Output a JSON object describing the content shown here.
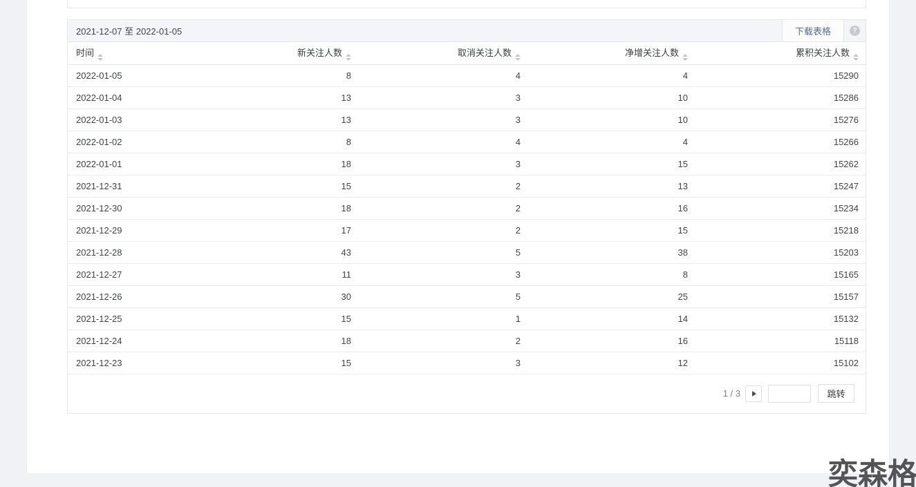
{
  "page": {
    "watermark": "奕森格"
  },
  "card": {
    "date_range": "2021-12-07 至 2022-01-05",
    "download_label": "下载表格",
    "help_icon_glyph": "?",
    "columns": [
      {
        "label": "时间",
        "align": "left"
      },
      {
        "label": "新关注人数",
        "align": "right"
      },
      {
        "label": "取消关注人数",
        "align": "right"
      },
      {
        "label": "净增关注人数",
        "align": "right"
      },
      {
        "label": "累积关注人数",
        "align": "right"
      }
    ],
    "rows": [
      [
        "2022-01-05",
        "8",
        "4",
        "4",
        "15290"
      ],
      [
        "2022-01-04",
        "13",
        "3",
        "10",
        "15286"
      ],
      [
        "2022-01-03",
        "13",
        "3",
        "10",
        "15276"
      ],
      [
        "2022-01-02",
        "8",
        "4",
        "4",
        "15266"
      ],
      [
        "2022-01-01",
        "18",
        "3",
        "15",
        "15262"
      ],
      [
        "2021-12-31",
        "15",
        "2",
        "13",
        "15247"
      ],
      [
        "2021-12-30",
        "18",
        "2",
        "16",
        "15234"
      ],
      [
        "2021-12-29",
        "17",
        "2",
        "15",
        "15218"
      ],
      [
        "2021-12-28",
        "43",
        "5",
        "38",
        "15203"
      ],
      [
        "2021-12-27",
        "11",
        "3",
        "8",
        "15165"
      ],
      [
        "2021-12-26",
        "30",
        "5",
        "25",
        "15157"
      ],
      [
        "2021-12-25",
        "15",
        "1",
        "14",
        "15132"
      ],
      [
        "2021-12-24",
        "18",
        "2",
        "16",
        "15118"
      ],
      [
        "2021-12-23",
        "15",
        "3",
        "12",
        "15102"
      ]
    ],
    "pagination": {
      "page_text": "1 / 3",
      "current_page": "1",
      "total_pages": "3",
      "input_value": "",
      "jump_label": "跳转"
    }
  },
  "colors": {
    "link_blue": "#576b95",
    "page_bg": "#f1f2f6",
    "header_bar_bg": "#f4f5f8",
    "border": "#e7e7eb",
    "watermark_gray": "#545457"
  }
}
